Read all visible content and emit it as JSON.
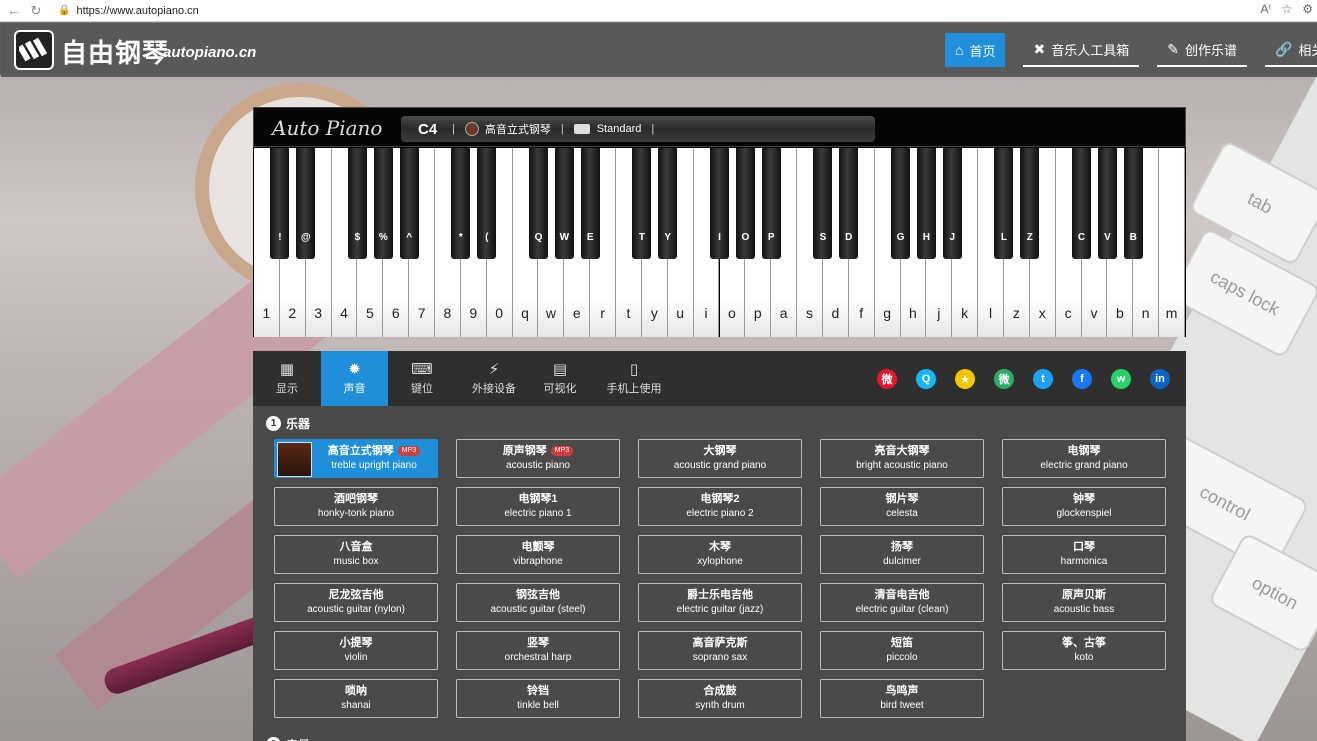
{
  "browser": {
    "url": "https://www.autopiano.cn"
  },
  "header": {
    "title": "自由钢琴",
    "domain": "autopiano.cn",
    "nav": [
      {
        "label": "首页",
        "icon": "home-icon"
      },
      {
        "label": "音乐人工具箱",
        "icon": "tools-icon"
      },
      {
        "label": "创作乐谱",
        "icon": "pen-icon"
      },
      {
        "label": "相关链",
        "icon": "link-icon"
      }
    ]
  },
  "piano": {
    "brand": "Auto Piano",
    "note": "C4",
    "instrument": "高音立式钢琴",
    "keymap": "Standard",
    "white_keys": [
      "1",
      "2",
      "3",
      "4",
      "5",
      "6",
      "7",
      "8",
      "9",
      "0",
      "q",
      "w",
      "e",
      "r",
      "t",
      "y",
      "u",
      "i",
      "o",
      "p",
      "a",
      "s",
      "d",
      "f",
      "g",
      "h",
      "j",
      "k",
      "l",
      "z",
      "x",
      "c",
      "v",
      "b",
      "n",
      "m"
    ],
    "black_keys": [
      "!",
      "@",
      "$",
      "%",
      "^",
      "*",
      "(",
      "Q",
      "W",
      "E",
      "T",
      "Y",
      "I",
      "O",
      "P",
      "S",
      "D",
      "G",
      "H",
      "J",
      "L",
      "Z",
      "C",
      "V",
      "B"
    ]
  },
  "tabs": [
    {
      "label": "显示",
      "icon": "piano-icon"
    },
    {
      "label": "声音",
      "icon": "sound-icon"
    },
    {
      "label": "键位",
      "icon": "keyboard-icon"
    },
    {
      "label": "外接设备",
      "icon": "plug-icon"
    },
    {
      "label": "可视化",
      "icon": "bar-chart-icon"
    },
    {
      "label": "手机上使用",
      "icon": "mobile-icon"
    }
  ],
  "social": [
    {
      "name": "weibo-icon",
      "glyph": "微",
      "color": "#e6162d"
    },
    {
      "name": "qq-icon",
      "glyph": "Q",
      "color": "#12b7f5"
    },
    {
      "name": "qzone-icon",
      "glyph": "★",
      "color": "#f7c600"
    },
    {
      "name": "wechat-icon",
      "glyph": "微",
      "color": "#2aae67"
    },
    {
      "name": "twitter-icon",
      "glyph": "t",
      "color": "#1da1f2"
    },
    {
      "name": "facebook-icon",
      "glyph": "f",
      "color": "#1877f2"
    },
    {
      "name": "whatsapp-icon",
      "glyph": "w",
      "color": "#25d366"
    },
    {
      "name": "linkedin-icon",
      "glyph": "in",
      "color": "#0a66c2"
    }
  ],
  "instruments_section": {
    "number": "1",
    "title": "乐器",
    "mp3_badge": "MP3",
    "items": [
      {
        "cn": "高音立式钢琴",
        "en": "treble upright piano",
        "mp3": true
      },
      {
        "cn": "原声钢琴",
        "en": "acoustic piano",
        "mp3": true
      },
      {
        "cn": "大钢琴",
        "en": "acoustic grand piano"
      },
      {
        "cn": "亮音大钢琴",
        "en": "bright acoustic piano"
      },
      {
        "cn": "电钢琴",
        "en": "electric grand piano"
      },
      {
        "cn": "酒吧钢琴",
        "en": "honky-tonk piano"
      },
      {
        "cn": "电钢琴1",
        "en": "electric piano 1"
      },
      {
        "cn": "电钢琴2",
        "en": "electric piano 2"
      },
      {
        "cn": "钢片琴",
        "en": "celesta"
      },
      {
        "cn": "钟琴",
        "en": "glockenspiel"
      },
      {
        "cn": "八音盒",
        "en": "music box"
      },
      {
        "cn": "电颤琴",
        "en": "vibraphone"
      },
      {
        "cn": "木琴",
        "en": "xylophone"
      },
      {
        "cn": "扬琴",
        "en": "dulcimer"
      },
      {
        "cn": "口琴",
        "en": "harmonica"
      },
      {
        "cn": "尼龙弦吉他",
        "en": "acoustic guitar (nylon)"
      },
      {
        "cn": "钢弦吉他",
        "en": "acoustic guitar (steel)"
      },
      {
        "cn": "爵士乐电吉他",
        "en": "electric guitar (jazz)"
      },
      {
        "cn": "清音电吉他",
        "en": "electric guitar (clean)"
      },
      {
        "cn": "原声贝斯",
        "en": "acoustic bass"
      },
      {
        "cn": "小提琴",
        "en": "violin"
      },
      {
        "cn": "竖琴",
        "en": "orchestral harp"
      },
      {
        "cn": "高音萨克斯",
        "en": "soprano sax"
      },
      {
        "cn": "短笛",
        "en": "piccolo"
      },
      {
        "cn": "筝、古筝",
        "en": "koto"
      },
      {
        "cn": "唢呐",
        "en": "shanai"
      },
      {
        "cn": "铃铛",
        "en": "tinkle bell"
      },
      {
        "cn": "合成鼓",
        "en": "synth drum"
      },
      {
        "cn": "鸟鸣声",
        "en": "bird tweet"
      }
    ]
  },
  "next_section": {
    "number": "2",
    "title": "音量"
  },
  "background": {
    "keyboard_keys": [
      "tab",
      "caps lock",
      "control",
      "option"
    ]
  }
}
